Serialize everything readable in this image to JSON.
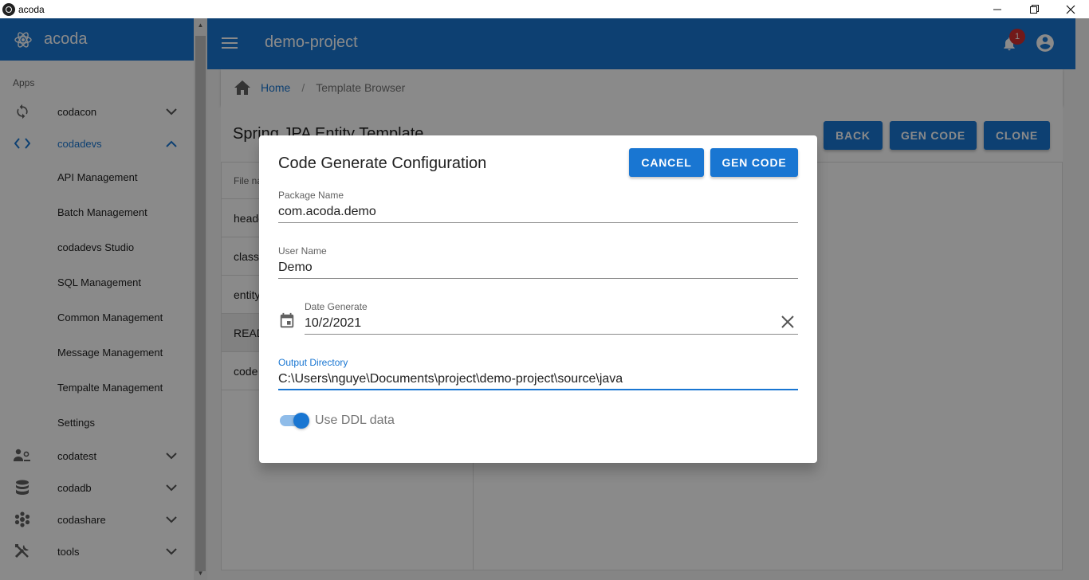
{
  "window": {
    "title": "acoda",
    "controls": [
      "—",
      "❐",
      "✕"
    ]
  },
  "sidebar": {
    "brand": "acoda",
    "section": "Apps",
    "groups": [
      {
        "label": "codacon",
        "icon": "sync-icon",
        "expanded": false
      },
      {
        "label": "codadevs",
        "icon": "code-icon",
        "expanded": true,
        "children": [
          "API Management",
          "Batch Management",
          "codadevs Studio",
          "SQL Management",
          "Common Management",
          "Message Management",
          "Tempalte Management",
          "Settings"
        ]
      },
      {
        "label": "codatest",
        "icon": "users-settings-icon",
        "expanded": false
      },
      {
        "label": "codadb",
        "icon": "database-icon",
        "expanded": false
      },
      {
        "label": "codashare",
        "icon": "share-cluster-icon",
        "expanded": false
      },
      {
        "label": "tools",
        "icon": "tools-icon",
        "expanded": false
      }
    ]
  },
  "appbar": {
    "project": "demo-project",
    "notifications": "1"
  },
  "breadcrumb": {
    "home": "Home",
    "separator": "/",
    "current": "Template Browser"
  },
  "content": {
    "title": "Spring JPA Entity Template",
    "buttons": {
      "back": "BACK",
      "gen_code": "GEN CODE",
      "clone": "CLONE"
    },
    "files": {
      "header": "File name",
      "rows": [
        "header",
        "class",
        "entity",
        "README",
        "code"
      ]
    }
  },
  "dialog": {
    "title": "Code Generate Configuration",
    "cancel": "CANCEL",
    "gen_code": "GEN CODE",
    "fields": {
      "package": {
        "label": "Package Name",
        "value": "com.acoda.demo"
      },
      "user": {
        "label": "User Name",
        "value": "Demo"
      },
      "date": {
        "label": "Date Generate",
        "value": "10/2/2021"
      },
      "output": {
        "label": "Output Directory",
        "value": "C:\\Users\\nguye\\Documents\\project\\demo-project\\source\\java"
      }
    },
    "toggle": {
      "label": "Use DDL data",
      "checked": true
    }
  },
  "colors": {
    "primary": "#1976d2",
    "badge": "#d32f2f"
  }
}
